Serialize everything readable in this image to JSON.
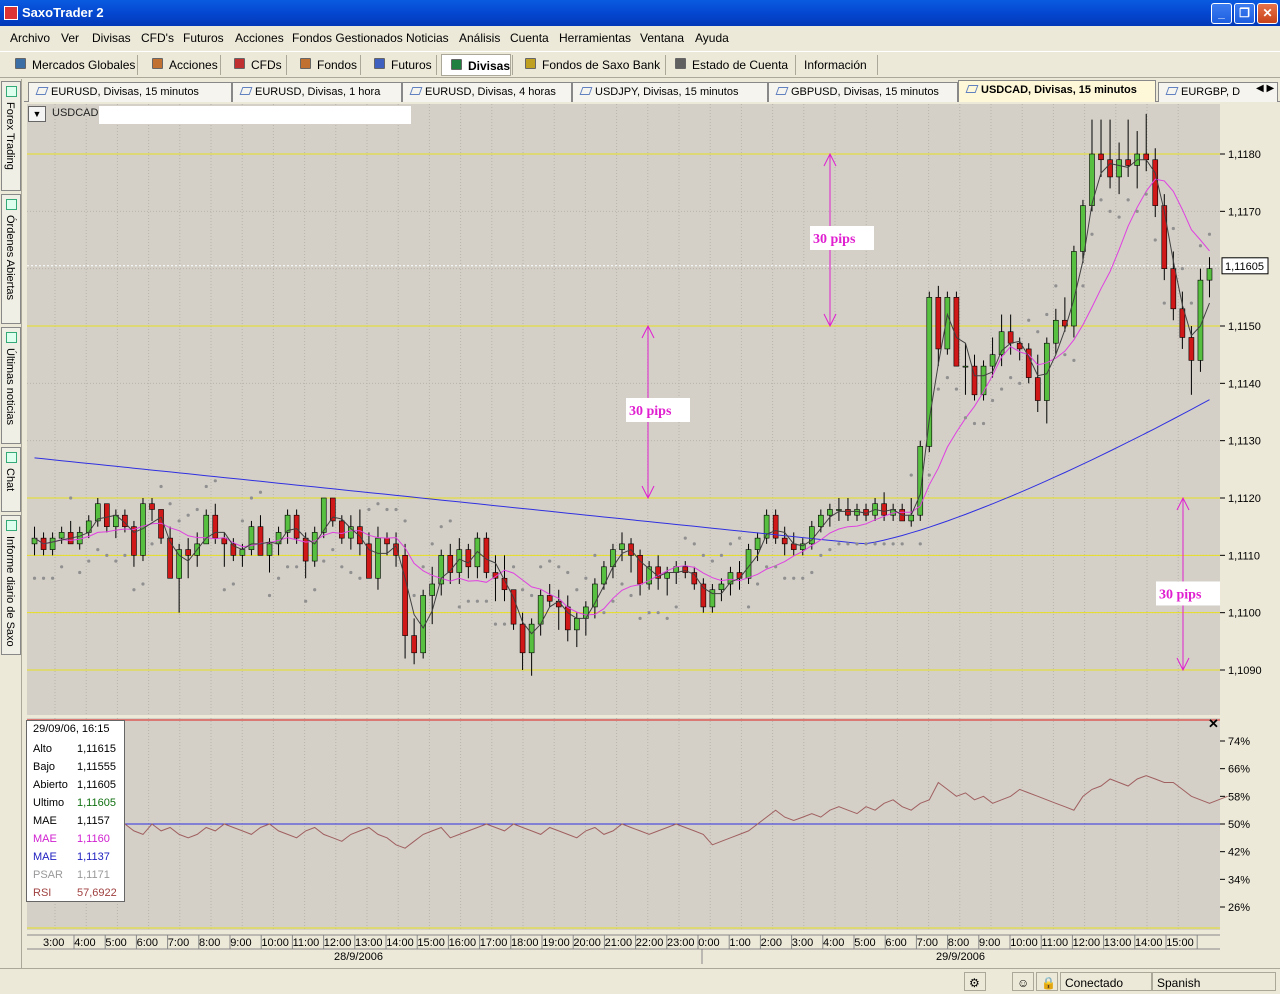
{
  "window": {
    "title": "SaxoTrader 2",
    "controls": {
      "minimize": "_",
      "maximize": "❐",
      "close": "✕"
    }
  },
  "menu": [
    "Archivo",
    "Ver",
    "Divisas",
    "CFD's",
    "Futuros",
    "Acciones",
    "Fondos Gestionados",
    "Noticias",
    "Análisis",
    "Cuenta",
    "Herramientas",
    "Ventana",
    "Ayuda"
  ],
  "toolbar": {
    "buttons": [
      {
        "label": "Mercados Globales",
        "icon": "globe-icon",
        "color": "#3a6ea5"
      },
      {
        "label": "Acciones",
        "icon": "stocks-icon",
        "color": "#c07030"
      },
      {
        "label": "CFDs",
        "icon": "cfd-icon",
        "color": "#c03030"
      },
      {
        "label": "Fondos",
        "icon": "funds-icon",
        "color": "#c07030"
      },
      {
        "label": "Futuros",
        "icon": "futures-icon",
        "color": "#4060c0"
      },
      {
        "label": "Divisas",
        "icon": "fx-icon",
        "color": "#208040",
        "active": true
      },
      {
        "label": "Fondos de Saxo Bank",
        "icon": "saxo-funds-icon",
        "color": "#c0a020"
      },
      {
        "label": "Estado de Cuenta",
        "icon": "account-icon",
        "color": "#606060"
      },
      {
        "label": "Información",
        "icon": "",
        "color": ""
      }
    ]
  },
  "chart_tabs": [
    "EURUSD, Divisas, 15 minutos",
    "EURUSD, Divisas, 1 hora",
    "EURUSD, Divisas, 4 horas",
    "USDJPY, Divisas, 15 minutos",
    "GBPUSD, Divisas, 15 minutos",
    "USDCAD, Divisas, 15 minutos",
    "EURGBP, D"
  ],
  "active_tab_index": 5,
  "sidebar": [
    "Forex Trading",
    "Órdenes Abiertas",
    "Últimas noticias",
    "Chat",
    "Informe diario de Saxo"
  ],
  "chart": {
    "symbol": "USDCAD",
    "current_price": "1,11605",
    "price_ticks": [
      "1,1180",
      "1,1170",
      "1,1150",
      "1,1140",
      "1,1130",
      "1,1120",
      "1,1110",
      "1,1100",
      "1,1090"
    ],
    "rsi_ticks": [
      "74%",
      "66%",
      "58%",
      "50%",
      "42%",
      "34%",
      "26%"
    ],
    "time_labels": [
      "3:00",
      "4:00",
      "5:00",
      "6:00",
      "7:00",
      "8:00",
      "9:00",
      "10:00",
      "11:00",
      "12:00",
      "13:00",
      "14:00",
      "15:00",
      "16:00",
      "17:00",
      "18:00",
      "19:00",
      "20:00",
      "21:00",
      "22:00",
      "23:00",
      "0:00",
      "1:00",
      "2:00",
      "3:00",
      "4:00",
      "5:00",
      "6:00",
      "7:00",
      "8:00",
      "9:00",
      "10:00",
      "11:00",
      "12:00",
      "13:00",
      "14:00",
      "15:00"
    ],
    "dates": [
      "28/9/2006",
      "29/9/2006"
    ],
    "annotations": [
      "30 pips",
      "30 pips",
      "30 pips"
    ],
    "colors": {
      "bg": "#d4d0c8",
      "up": "#58c040",
      "down": "#d01818",
      "mae_fast": "#404040",
      "mae_mid": "#e040e0",
      "mae_slow": "#3030e0",
      "psar": "#909090",
      "level": "#e8e020",
      "rsi": "#a06060",
      "annotation": "#e020d0"
    }
  },
  "infobox": {
    "date": "29/09/06, 16:15",
    "rows": [
      {
        "k": "Alto",
        "v": "1,11615",
        "kc": "#000",
        "vc": "#000"
      },
      {
        "k": "Bajo",
        "v": "1,11555",
        "kc": "#000",
        "vc": "#000"
      },
      {
        "k": "Abierto",
        "v": "1,11605",
        "kc": "#000",
        "vc": "#000"
      },
      {
        "k": "Ultimo",
        "v": "1,11605",
        "kc": "#000",
        "vc": "#107010"
      },
      {
        "k": "MAE",
        "v": "1,1157",
        "kc": "#000",
        "vc": "#000"
      },
      {
        "k": "MAE",
        "v": "1,1160",
        "kc": "#d020d0",
        "vc": "#d020d0"
      },
      {
        "k": "MAE",
        "v": "1,1137",
        "kc": "#2020c0",
        "vc": "#2020c0"
      },
      {
        "k": "PSAR",
        "v": "1,1171",
        "kc": "#999",
        "vc": "#999"
      },
      {
        "k": "RSI",
        "v": "57,6922",
        "kc": "#a04040",
        "vc": "#a04040"
      }
    ]
  },
  "status": {
    "connection": "Conectado",
    "language": "Spanish"
  }
}
